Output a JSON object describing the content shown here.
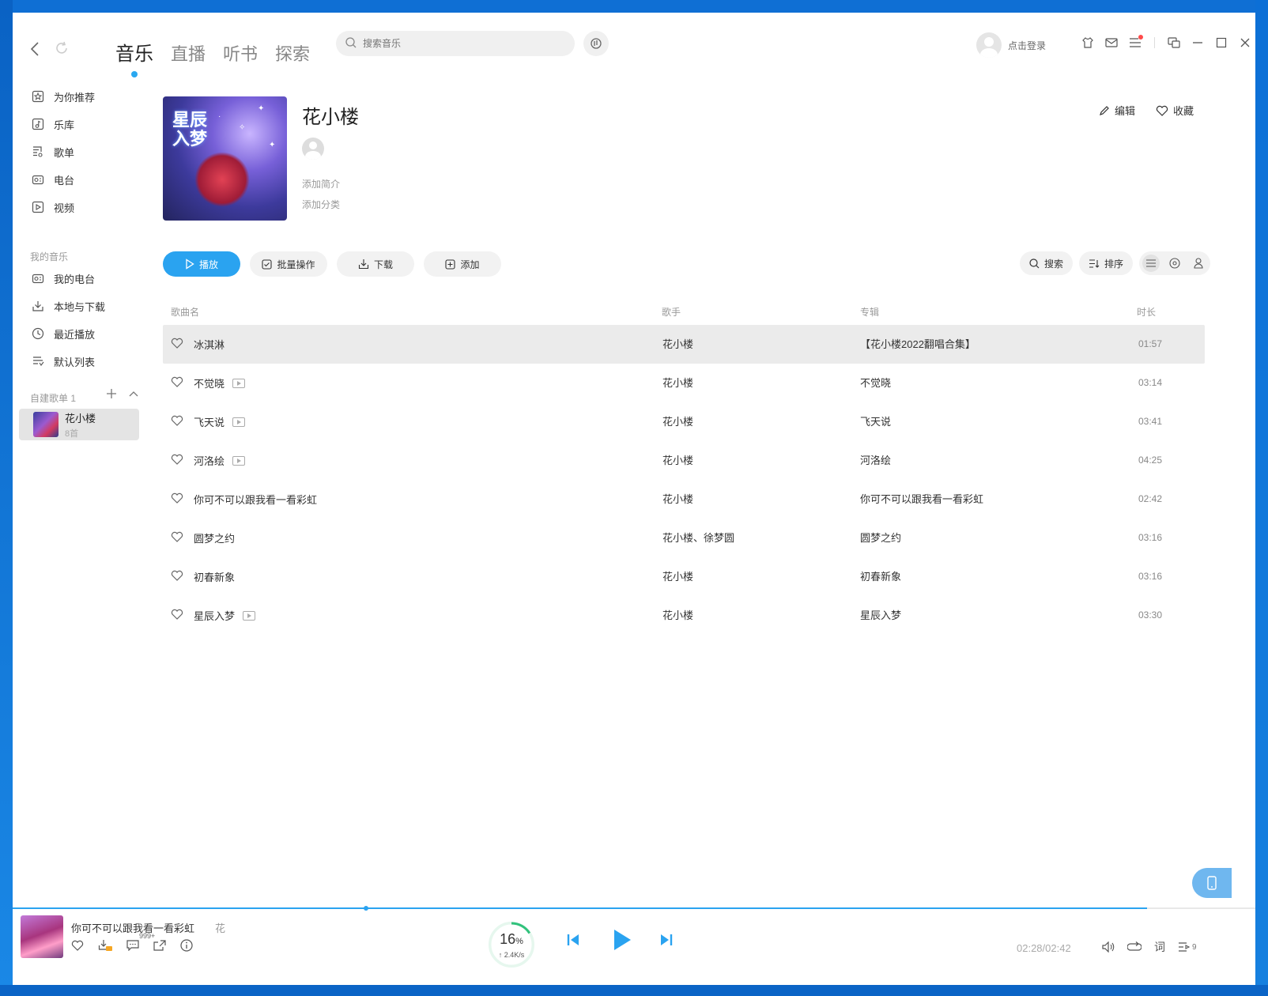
{
  "topbar": {
    "tabs": [
      "音乐",
      "直播",
      "听书",
      "探索"
    ],
    "search_placeholder": "搜索音乐",
    "login_text": "点击登录"
  },
  "sidebar": {
    "main_items": [
      "为你推荐",
      "乐库",
      "歌单",
      "电台",
      "视频"
    ],
    "my_music_label": "我的音乐",
    "my_items": [
      "我的电台",
      "本地与下载",
      "最近播放",
      "默认列表"
    ],
    "created_label": "自建歌单 1",
    "playlist": {
      "name": "花小楼",
      "count": "8首"
    }
  },
  "playlist": {
    "title": "花小楼",
    "add_intro": "添加简介",
    "add_category": "添加分类",
    "edit_label": "编辑",
    "favorite_label": "收藏",
    "cover_text": "星辰入梦"
  },
  "toolbar": {
    "play": "播放",
    "batch": "批量操作",
    "download": "下载",
    "add": "添加",
    "search": "搜索",
    "sort": "排序"
  },
  "table": {
    "headers": {
      "song": "歌曲名",
      "singer": "歌手",
      "album": "专辑",
      "duration": "时长"
    },
    "rows": [
      {
        "song": "冰淇淋",
        "singer": "花小楼",
        "album": "【花小楼2022翻唱合集】",
        "duration": "01:57",
        "mv": false
      },
      {
        "song": "不觉晓",
        "singer": "花小楼",
        "album": "不觉晓",
        "duration": "03:14",
        "mv": true
      },
      {
        "song": "飞天说",
        "singer": "花小楼",
        "album": "飞天说",
        "duration": "03:41",
        "mv": true
      },
      {
        "song": "河洛绘",
        "singer": "花小楼",
        "album": "河洛绘",
        "duration": "04:25",
        "mv": true
      },
      {
        "song": "你可不可以跟我看一看彩虹",
        "singer": "花小楼",
        "album": "你可不可以跟我看一看彩虹",
        "duration": "02:42",
        "mv": false
      },
      {
        "song": "圆梦之约",
        "singer": "花小楼、徐梦圆",
        "album": "圆梦之约",
        "duration": "03:16",
        "mv": false
      },
      {
        "song": "初春新象",
        "singer": "花小楼",
        "album": "初春新象",
        "duration": "03:16",
        "mv": false
      },
      {
        "song": "星辰入梦",
        "singer": "花小楼",
        "album": "星辰入梦",
        "duration": "03:30",
        "mv": true
      }
    ]
  },
  "player": {
    "title": "你可不可以跟我看一看彩虹",
    "artist": "花",
    "comments_badge": "999+",
    "speed_percent": "16",
    "speed_unit": "%",
    "upload_rate": "↑ 2.4K/s",
    "time": "02:28/02:42",
    "progress_fraction": 0.913,
    "lyrics_label": "词",
    "queue_count": "9"
  },
  "colors": {
    "accent": "#2aa3f0",
    "speed_ring": "#31c27c"
  }
}
